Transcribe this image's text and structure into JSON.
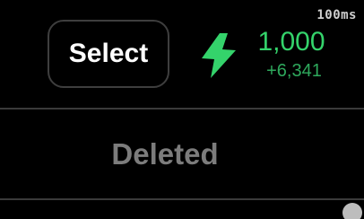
{
  "timing_label": "100ms",
  "actions": {
    "select_label": "Select"
  },
  "balance": {
    "value": "1,000",
    "delta": "+6,341",
    "icon": "lightning-bolt-icon",
    "accent_color": "#34d36b"
  },
  "status": {
    "label": "Deleted"
  }
}
